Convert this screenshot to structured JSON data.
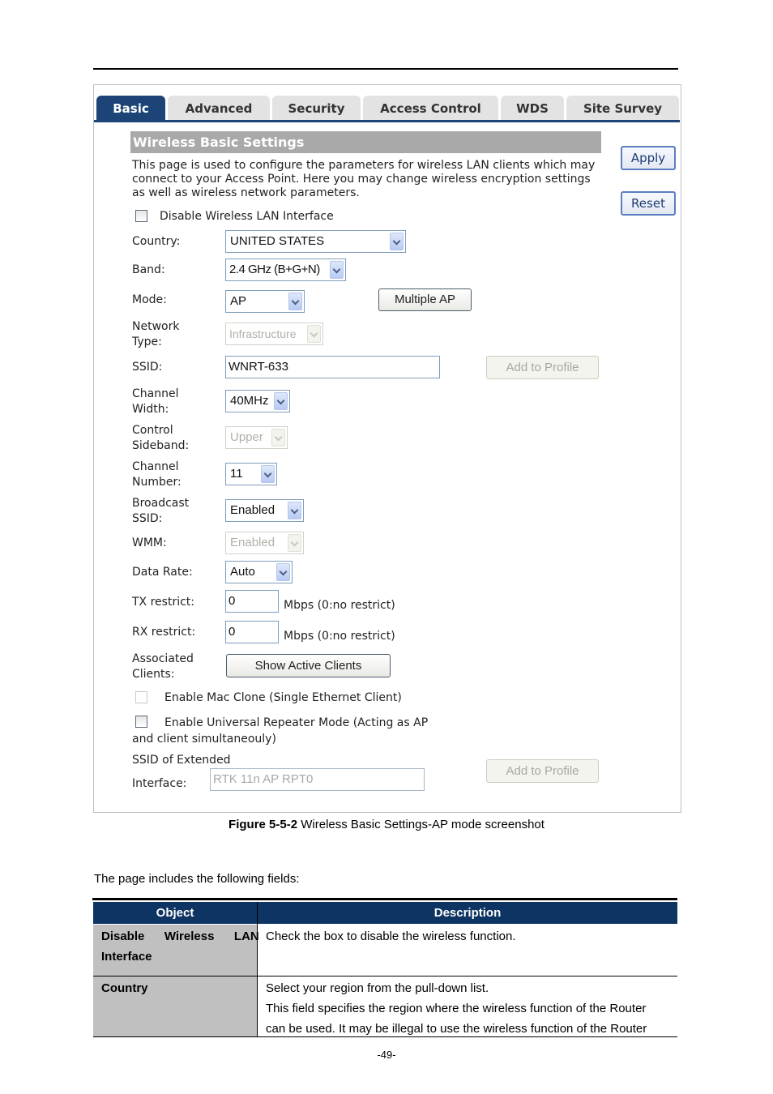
{
  "tabs": [
    {
      "label": "Basic",
      "active": true
    },
    {
      "label": "Advanced",
      "active": false
    },
    {
      "label": "Security",
      "active": false
    },
    {
      "label": "Access Control",
      "active": false
    },
    {
      "label": "WDS",
      "active": false
    },
    {
      "label": "Site Survey",
      "active": false
    }
  ],
  "section_title": "Wireless Basic Settings",
  "intro": "This page is used to configure the parameters for wireless LAN clients which may connect to your Access Point. Here you may change wireless encryption settings as well as wireless network parameters.",
  "buttons": {
    "apply": "Apply",
    "reset": "Reset",
    "multiple_ap": "Multiple AP",
    "add_to_profile": "Add to Profile",
    "show_active_clients": "Show Active Clients"
  },
  "form": {
    "disable_wlan_label": "Disable Wireless LAN Interface",
    "country_label": "Country:",
    "country_value": "UNITED STATES",
    "band_label": "Band:",
    "band_value": "2.4 GHz (B+G+N)",
    "mode_label": "Mode:",
    "mode_value": "AP",
    "network_type_label_1": "Network",
    "network_type_label_2": "Type:",
    "network_type_value": "Infrastructure",
    "ssid_label": "SSID:",
    "ssid_value": "WNRT-633",
    "channel_width_label_1": "Channel",
    "channel_width_label_2": "Width:",
    "channel_width_value": "40MHz",
    "control_sideband_label_1": "Control",
    "control_sideband_label_2": "Sideband:",
    "control_sideband_value": "Upper",
    "channel_number_label_1": "Channel",
    "channel_number_label_2": "Number:",
    "channel_number_value": "11",
    "broadcast_ssid_label_1": "Broadcast",
    "broadcast_ssid_label_2": "SSID:",
    "broadcast_ssid_value": "Enabled",
    "wmm_label": "WMM:",
    "wmm_value": "Enabled",
    "data_rate_label": "Data Rate:",
    "data_rate_value": "Auto",
    "tx_restrict_label": "TX restrict:",
    "tx_restrict_value": "0",
    "rx_restrict_label": "RX restrict:",
    "rx_restrict_value": "0",
    "mbps_hint": "Mbps (0:no restrict)",
    "associated_clients_label_1": "Associated",
    "associated_clients_label_2": "Clients:",
    "mac_clone_label": "Enable Mac Clone (Single Ethernet Client)",
    "repeater_label_1": "Enable Universal Repeater Mode (Acting as AP",
    "repeater_label_2": "and client simultaneouly)",
    "extended_ssid_label_1": "SSID of Extended",
    "extended_ssid_label_2": "Interface:",
    "extended_ssid_value": "RTK 11n AP RPT0"
  },
  "caption": {
    "bold": "Figure 5-5-2",
    "text": " Wireless Basic Settings-AP mode screenshot"
  },
  "paragraph": "The page includes the following fields:",
  "table": {
    "headers": [
      "Object",
      "Description"
    ],
    "rows": [
      {
        "object_1": "Disable   Wireless   LAN",
        "object_2": "Interface",
        "desc": [
          "Check the box to disable the wireless function."
        ]
      },
      {
        "object_1": "Country",
        "object_2": "",
        "desc": [
          "Select your region from the pull-down list.",
          "This field specifies the region where the wireless function of the Router",
          "can be used. It may be illegal to use the wireless function of the Router"
        ]
      }
    ]
  },
  "page_number": "-49-"
}
